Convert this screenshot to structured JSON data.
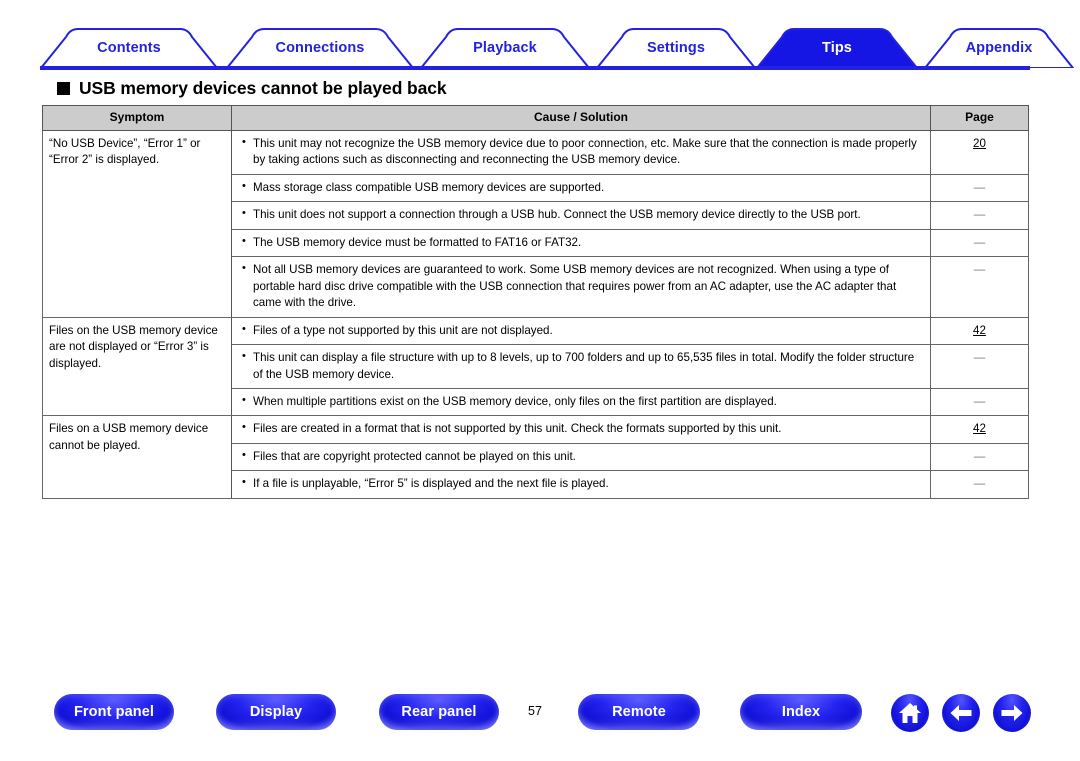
{
  "tabs": [
    {
      "label": "Contents",
      "active": false
    },
    {
      "label": "Connections",
      "active": false
    },
    {
      "label": "Playback",
      "active": false
    },
    {
      "label": "Settings",
      "active": false
    },
    {
      "label": "Tips",
      "active": true
    },
    {
      "label": "Appendix",
      "active": false
    }
  ],
  "section": {
    "title": "USB memory devices cannot be played back"
  },
  "table": {
    "headers": {
      "symptom": "Symptom",
      "cause": "Cause / Solution",
      "page": "Page"
    },
    "groups": [
      {
        "symptom": "“No USB Device”, “Error 1” or “Error 2” is displayed.",
        "rows": [
          {
            "cause": "This unit may not recognize the USB memory device due to poor connection, etc. Make sure that the connection is made properly by taking actions such as disconnecting and reconnecting the USB memory device.",
            "page": "20",
            "page_link": true
          },
          {
            "cause": "Mass storage class compatible USB memory devices are supported.",
            "page": "—",
            "page_link": false
          },
          {
            "cause": "This unit does not support a connection through a USB hub. Connect the USB memory device directly to the USB port.",
            "page": "—",
            "page_link": false
          },
          {
            "cause": "The USB memory device must be formatted to FAT16 or FAT32.",
            "page": "—",
            "page_link": false
          },
          {
            "cause": "Not all USB memory devices are guaranteed to work. Some USB memory devices are not recognized. When using a type of portable hard disc drive compatible with the USB connection that requires power from an AC adapter, use the AC adapter that came with the drive.",
            "page": "—",
            "page_link": false
          }
        ]
      },
      {
        "symptom": "Files on the USB memory device are not displayed or “Error 3” is displayed.",
        "rows": [
          {
            "cause": "Files of a type not supported by this unit are not displayed.",
            "page": "42",
            "page_link": true
          },
          {
            "cause": "This unit can display a file structure with up to 8 levels, up to 700 folders and up to 65,535 files in total. Modify the folder structure of the USB memory device.",
            "page": "—",
            "page_link": false
          },
          {
            "cause": "When multiple partitions exist on the USB memory device, only files on the first partition are displayed.",
            "page": "—",
            "page_link": false
          }
        ]
      },
      {
        "symptom": "Files on a USB memory device cannot be played.",
        "rows": [
          {
            "cause": "Files are created in a format that is not supported by this unit. Check the formats supported by this unit.",
            "page": "42",
            "page_link": true
          },
          {
            "cause": "Files that are copyright protected cannot be played on this unit.",
            "page": "—",
            "page_link": false
          },
          {
            "cause": "If a file is unplayable, “Error 5” is displayed and the next file is played.",
            "page": "—",
            "page_link": false
          }
        ]
      }
    ]
  },
  "footer": {
    "buttons": [
      {
        "label": "Front panel"
      },
      {
        "label": "Display"
      },
      {
        "label": "Rear panel"
      },
      {
        "label": "Remote"
      },
      {
        "label": "Index"
      }
    ],
    "page_number": "57",
    "icons": [
      {
        "name": "home-icon"
      },
      {
        "name": "arrow-left-icon"
      },
      {
        "name": "arrow-right-icon"
      }
    ]
  },
  "colors": {
    "brand_blue": "#2222E0",
    "header_gray": "#CCCCCC",
    "border_gray": "#666666"
  }
}
